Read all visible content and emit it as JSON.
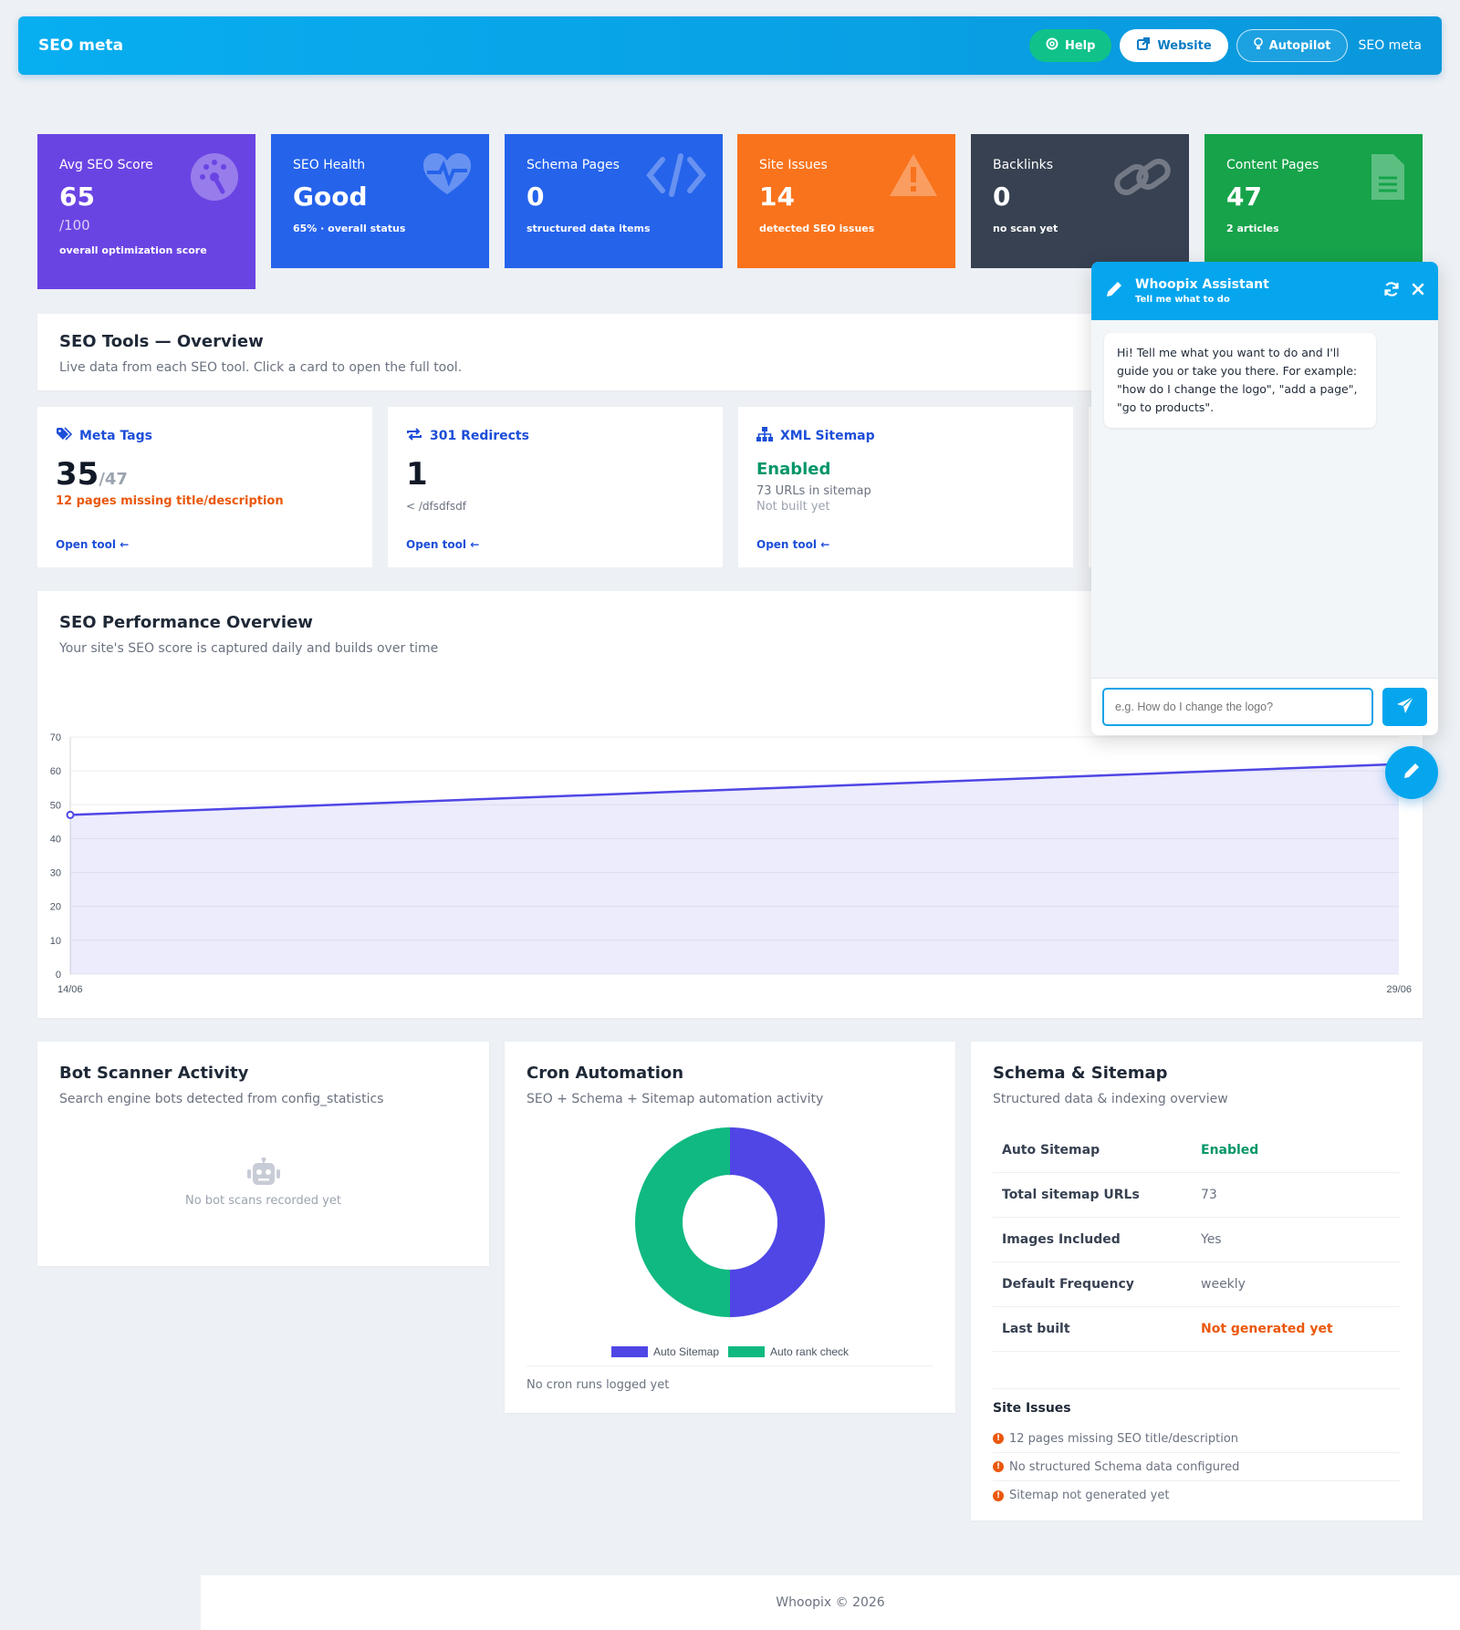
{
  "header": {
    "brand": "SEO meta",
    "help_label": "Help",
    "website_label": "Website",
    "autopilot_label": "Autopilot",
    "crumb": "SEO meta"
  },
  "stats": [
    {
      "label": "Avg SEO Score",
      "value": "65",
      "sub": "/100",
      "desc": "overall optimization score",
      "color": "#6a44e3",
      "icon": "gauge-icon"
    },
    {
      "label": "SEO Health",
      "value": "Good",
      "desc": "65% · overall status",
      "color": "#2563eb",
      "icon": "heart-pulse-icon"
    },
    {
      "label": "Schema Pages",
      "value": "0",
      "desc": "structured data items",
      "color": "#2563eb",
      "icon": "code-icon"
    },
    {
      "label": "Site Issues",
      "value": "14",
      "desc": "detected SEO issues",
      "color": "#f9731c",
      "icon": "warning-icon"
    },
    {
      "label": "Backlinks",
      "value": "0",
      "desc": "no scan yet",
      "color": "#374151",
      "icon": "link-icon"
    },
    {
      "label": "Content Pages",
      "value": "47",
      "desc": "2 articles",
      "color": "#16a34a",
      "icon": "file-icon"
    }
  ],
  "tools_overview": {
    "title": "SEO Tools — Overview",
    "subtitle": "Live data from each SEO tool. Click a card to open the full tool."
  },
  "tools": [
    {
      "title": "Meta Tags",
      "big": "35",
      "big_suffix": "/47",
      "line1": "12 pages missing title/description",
      "open": "Open tool"
    },
    {
      "title": "301 Redirects",
      "big": "1",
      "line1": "< /dfsdfsdf",
      "open": "Open tool"
    },
    {
      "title": "XML Sitemap",
      "big": "Enabled",
      "line1": "73 URLs in sitemap",
      "line2": "Not built yet",
      "open": "Open tool"
    }
  ],
  "performance": {
    "title": "SEO Performance Overview",
    "subtitle": "Your site's SEO score is captured daily and builds over time"
  },
  "chart_data": {
    "type": "area",
    "x": [
      "14/06",
      "29/06"
    ],
    "series": [
      {
        "values": [
          47,
          62
        ]
      }
    ],
    "ylim": [
      0,
      70
    ],
    "yticks": [
      0,
      10,
      20,
      30,
      40,
      50,
      60,
      70
    ],
    "grid": true,
    "color": "#4f46e5"
  },
  "bot": {
    "title": "Bot Scanner Activity",
    "subtitle": "Search engine bots detected from config_statistics",
    "empty": "No bot scans recorded yet"
  },
  "cron": {
    "title": "Cron Automation",
    "subtitle": "SEO + Schema + Sitemap automation activity",
    "donut": [
      {
        "name": "Auto Sitemap",
        "value": 50,
        "color": "#4f46e5"
      },
      {
        "name": "Auto rank check",
        "value": 50,
        "color": "#10b981"
      }
    ],
    "footer": "No cron runs logged yet"
  },
  "schema": {
    "title": "Schema & Sitemap",
    "subtitle": "Structured data & indexing overview",
    "rows": [
      {
        "k": "Auto Sitemap",
        "v": "Enabled"
      },
      {
        "k": "Total sitemap URLs",
        "v": "73"
      },
      {
        "k": "Images Included",
        "v": "Yes"
      },
      {
        "k": "Default Frequency",
        "v": "weekly"
      },
      {
        "k": "Last built",
        "v": "Not generated yet"
      }
    ],
    "issues_title": "Site Issues",
    "issues": [
      "12 pages missing SEO title/description",
      "No structured Schema data configured",
      "Sitemap not generated yet"
    ]
  },
  "chat": {
    "title": "Whoopix Assistant",
    "subtitle": "Tell me what to do",
    "message": "Hi! Tell me what you want to do and I'll guide you or take you there. For example: \"how do I change the logo\", \"add a page\", \"go to products\".",
    "placeholder": "e.g. How do I change the logo?"
  },
  "footer": "Whoopix © 2026"
}
